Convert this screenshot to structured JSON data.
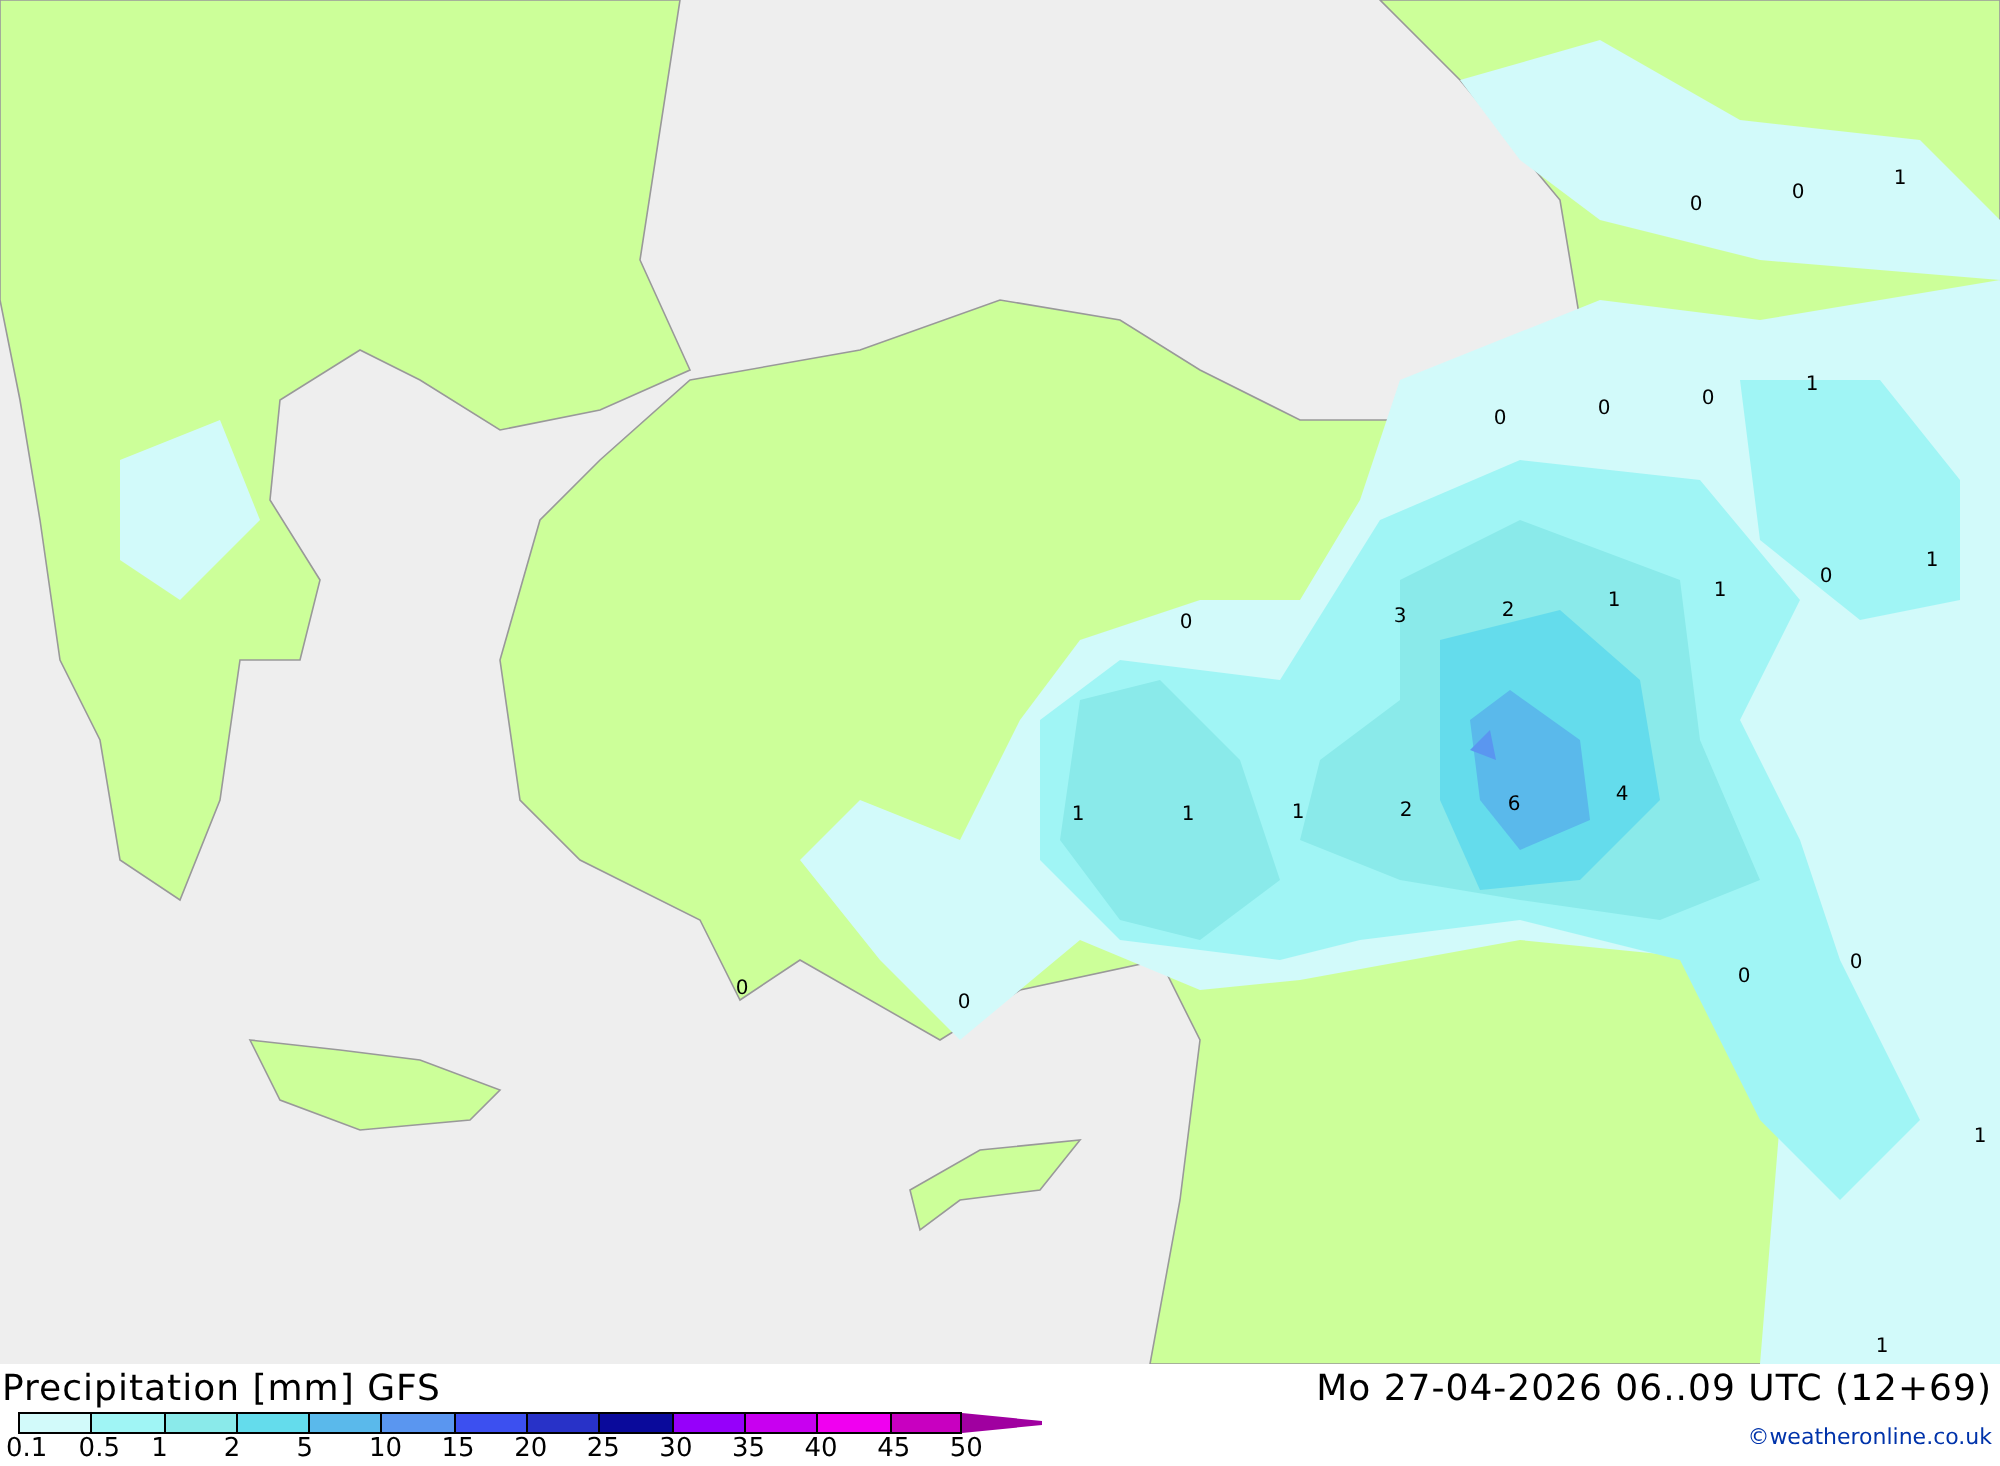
{
  "map": {
    "values": [
      "0",
      "0",
      "1",
      "0",
      "0",
      "0",
      "1",
      "0",
      "1",
      "0",
      "3",
      "2",
      "1",
      "1",
      "1",
      "1",
      "1",
      "2",
      "6",
      "4",
      "0",
      "0",
      "0",
      "0",
      "1",
      "1"
    ]
  },
  "title": "Precipitation [mm] GFS",
  "valid_time": "Mo 27-04-2026 06..09 UTC (12+69)",
  "scale": {
    "steps": [
      {
        "label": "0.1",
        "color": "#d2fafa",
        "kind": "box"
      },
      {
        "label": "0.5",
        "color": "#a0f5f5",
        "kind": "box"
      },
      {
        "label": "1",
        "color": "#8aeaea",
        "kind": "box"
      },
      {
        "label": "2",
        "color": "#64dcec",
        "kind": "box"
      },
      {
        "label": "5",
        "color": "#5ab9eb",
        "kind": "box"
      },
      {
        "label": "10",
        "color": "#5a96f0",
        "kind": "box"
      },
      {
        "label": "15",
        "color": "#3c50f0",
        "kind": "box"
      },
      {
        "label": "20",
        "color": "#2832c8",
        "kind": "box"
      },
      {
        "label": "25",
        "color": "#0a0a9b",
        "kind": "box"
      },
      {
        "label": "30",
        "color": "#9600fa",
        "kind": "box"
      },
      {
        "label": "35",
        "color": "#c800f0",
        "kind": "box"
      },
      {
        "label": "40",
        "color": "#f000f0",
        "kind": "box"
      },
      {
        "label": "45",
        "color": "#c800c0",
        "kind": "box"
      },
      {
        "label": "50",
        "color": "#a000a0",
        "kind": "arrow"
      }
    ]
  },
  "copyright": "©weatheronline.co.uk"
}
